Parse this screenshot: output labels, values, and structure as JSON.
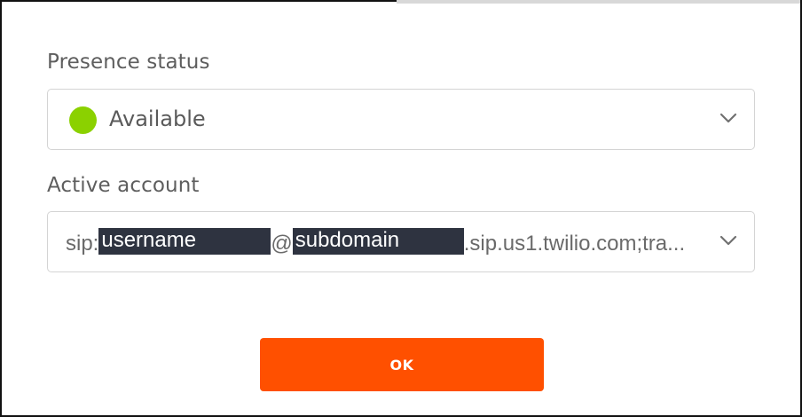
{
  "presence": {
    "label": "Presence status",
    "selected": "Available",
    "status_color": "#8bd100",
    "dropdown_icon": "chevron-down-icon"
  },
  "account": {
    "label": "Active account",
    "prefix": "sip:",
    "username": "username",
    "at": "@",
    "subdomain": "subdomain",
    "suffix": ".sip.us1.twilio.com;tra...",
    "dropdown_icon": "chevron-down-icon"
  },
  "actions": {
    "ok_label": "OK",
    "ok_color": "#ff5000"
  }
}
